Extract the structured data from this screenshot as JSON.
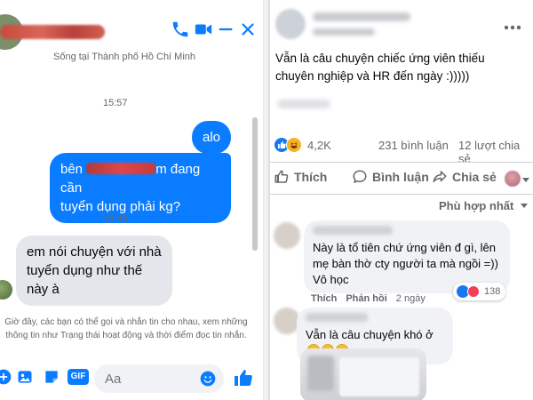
{
  "chat": {
    "subtitle": "Sống tại Thành phố Hồ Chí Minh",
    "messages": [
      {
        "time": "15:57"
      },
      {
        "text": "alo"
      },
      {
        "text_prefix": "bên ",
        "text_mid": "m đang cần",
        "text_line2": "tuyển dụng phải kg?"
      },
      {
        "time": "16:36"
      },
      {
        "line1": "em nói chuyện với nhà",
        "line2": "tuyển dụng như thế",
        "line3": "này à"
      }
    ],
    "notice": "Giờ đây, các bạn có thể gọi và nhắn tin cho nhau, xem những thông tin như Trạng thái hoạt động và thời điểm đọc tin nhắn.",
    "composer": {
      "placeholder": "Aa",
      "gif_label": "GIF"
    },
    "icons": [
      "phone-icon",
      "video-icon",
      "minimize-icon",
      "close-icon",
      "plus-icon",
      "image-icon",
      "sticker-icon",
      "gif-icon",
      "emoji-icon",
      "like-icon"
    ]
  },
  "post": {
    "text": "Vẫn là câu chuyện chiếc ứng viên thiếu chuyên nghiệp và HR đến ngày :)))))",
    "reaction_count": "4,2K",
    "comments_count": "231 bình luận",
    "shares_count": "12 lượt chia sẻ",
    "actions": {
      "like": "Thích",
      "comment": "Bình luận",
      "share": "Chia sẻ"
    },
    "sort_label": "Phù hợp nhất",
    "comments": [
      {
        "text": "Này là tổ tiên chứ ứng viên đ gì, lên mẹ bàn thờ cty người ta mà ngồi =)) Vô học",
        "like": "Thích",
        "reply": "Phản hồi",
        "age": "2 ngày",
        "reactions": "138"
      },
      {
        "text": "Vẫn là câu chuyện khó ở"
      }
    ],
    "colors": {
      "messenger_blue": "#0a7cff",
      "facebook_blue": "#1877f2",
      "bubble_gray": "#e4e6eb"
    }
  }
}
